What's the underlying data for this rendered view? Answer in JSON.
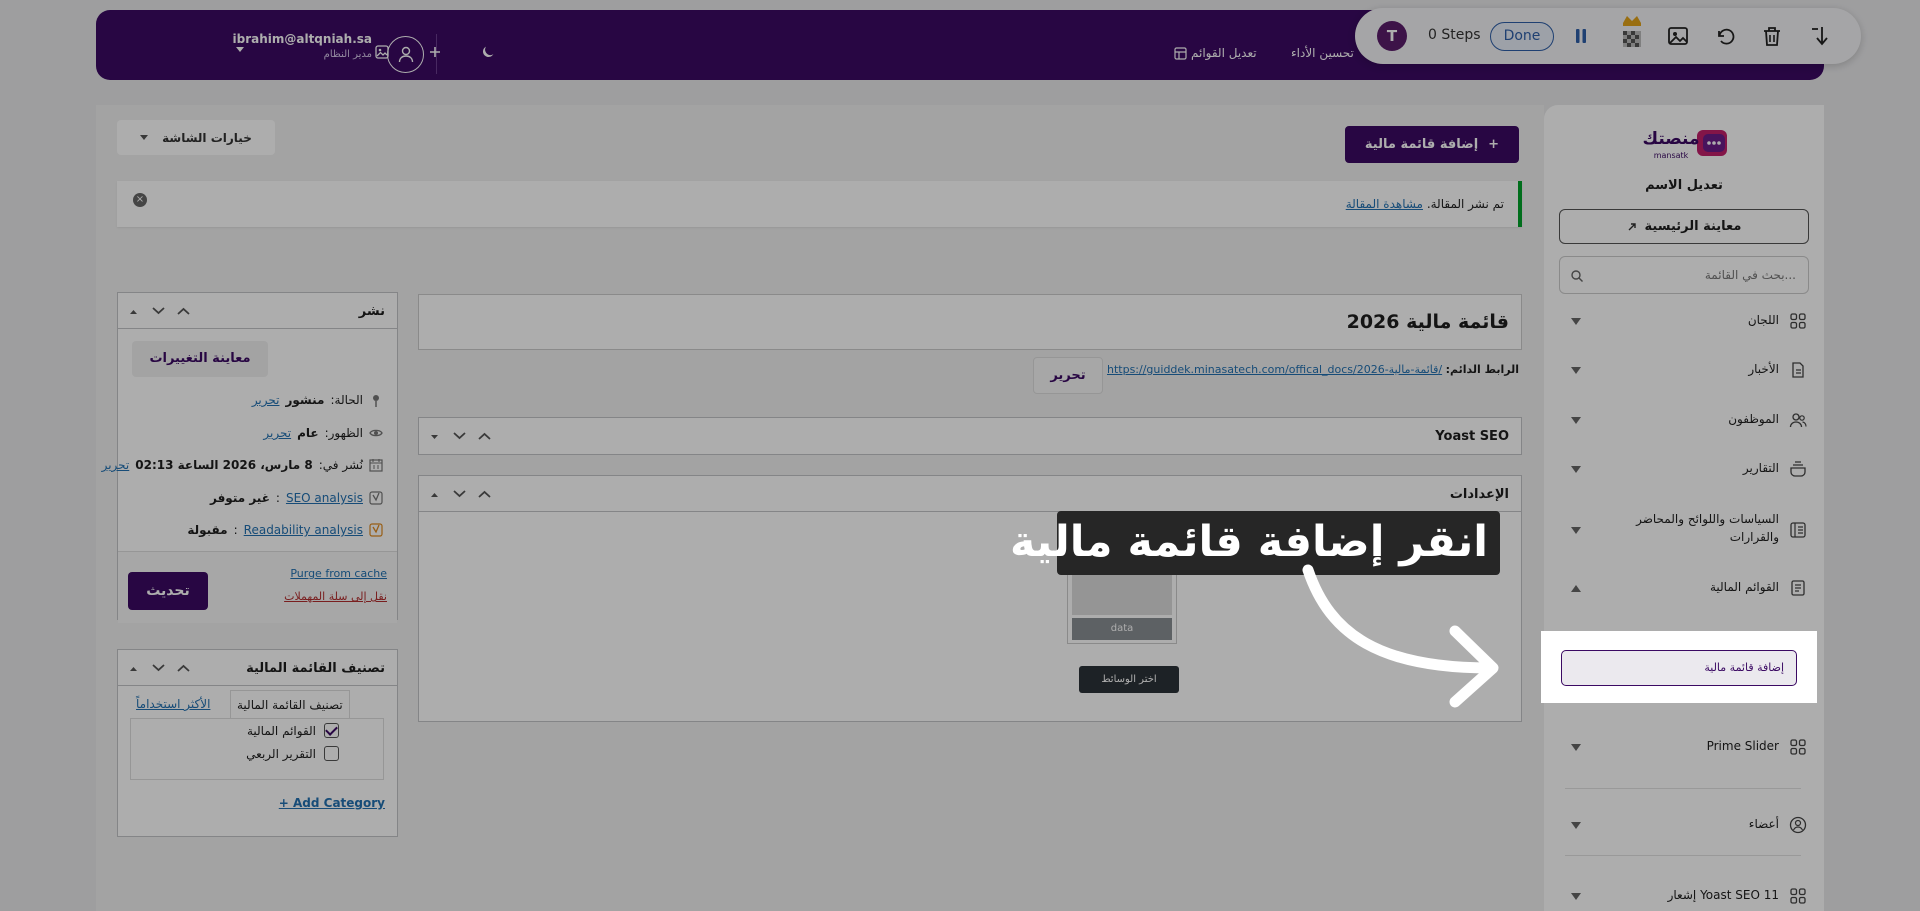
{
  "topbar": {
    "user_email": "ibrahim@altqniah.sa",
    "user_role": "مدير النظام",
    "link_performance": "تحسين الأداء",
    "link_edit_menus": "تعديل القوائم"
  },
  "recorder": {
    "logo_letter": "T",
    "steps": "0 Steps",
    "done": "Done"
  },
  "page": {
    "add_button": "إضافة قائمة مالية",
    "add_plus": "+",
    "screen_options": "خيارات الشاشة",
    "notice_text": "تم نشر المقالة.",
    "notice_link": "مشاهدة المقالة",
    "notice_close": "×",
    "post_title": "قائمة مالية 2026",
    "permalink_label": "الرابط الدائم:",
    "permalink_url": "https://guiddek.minasatech.com/offical_docs/قائمة-مالية-2026/",
    "permalink_edit": "تحرير"
  },
  "metaboxes": {
    "yoast": "Yoast SEO",
    "settings": "الإعدادات",
    "media_caption": "data",
    "media_button": "اختر الوسائط"
  },
  "publish": {
    "title": "نشر",
    "preview_changes": "معاينة التغييرات",
    "status_label": "الحالة:",
    "status_value": "منشور",
    "visibility_label": "الظهور:",
    "visibility_value": "عام",
    "published_label": "نُشر في:",
    "published_value": "8 مارس، 2026 الساعة 02:13",
    "edit": "تحرير",
    "seo_link": "SEO analysis",
    "seo_value": "غير متوفر",
    "read_link": "Readability analysis",
    "read_value": "مقبولة",
    "purge": "Purge from cache",
    "trash": "نقل إلى سلة المهملات",
    "update": "تحديث"
  },
  "category_box": {
    "title": "تصنيف القائمة المالية",
    "tab_all": "تصنيف القائمة المالية",
    "tab_popular": "الأكثر استخداماً",
    "items": [
      {
        "label": "القوائم المالية",
        "checked": true
      },
      {
        "label": "التقرير الربعي",
        "checked": false
      }
    ],
    "add_category": "+ Add Category"
  },
  "sidebar": {
    "logo_text": "منصتك",
    "logo_sub": "mansatk",
    "site_name": "تعديل الاسم",
    "home_button": "معاينة الرئيسية",
    "search_placeholder": "بحث في القائمة...",
    "items": [
      {
        "label": "اللجان",
        "icon": "grid-icon"
      },
      {
        "label": "الأخبار",
        "icon": "news-icon"
      },
      {
        "label": "الموظفون",
        "icon": "users-icon"
      },
      {
        "label": "التقارير",
        "icon": "reports-icon"
      },
      {
        "label": "السياسات واللوائح والمحاضر والقرارات",
        "icon": "policies-icon"
      },
      {
        "label": "القوائم المالية",
        "icon": "financial-icon"
      },
      {
        "label": "Prime Slider",
        "icon": "grid-icon"
      },
      {
        "label": "أعضاء",
        "icon": "user-circle-icon"
      },
      {
        "label": "Yoast SEO 11 إشعار",
        "icon": "grid-icon"
      }
    ],
    "submenu_add": "إضافة قائمة مالية"
  },
  "overlay": {
    "instruction": "انقر إضافة قائمة مالية"
  }
}
